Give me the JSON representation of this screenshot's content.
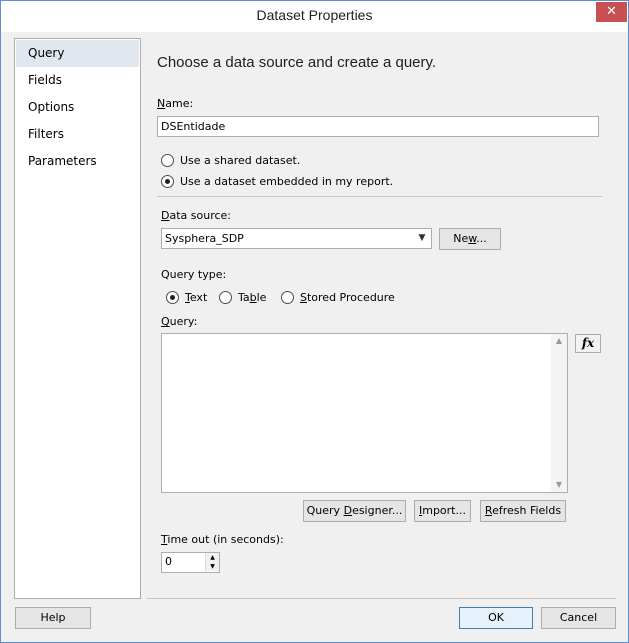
{
  "window": {
    "title": "Dataset Properties",
    "close_glyph": "✕"
  },
  "nav": {
    "items": [
      {
        "label": "Query",
        "selected": true
      },
      {
        "label": "Fields"
      },
      {
        "label": "Options"
      },
      {
        "label": "Filters"
      },
      {
        "label": "Parameters"
      }
    ]
  },
  "main": {
    "heading": "Choose a data source and create a query.",
    "name": {
      "label": {
        "key": "N",
        "suffix": "ame:"
      },
      "value": "DSEntidade"
    },
    "dataset_options": [
      {
        "label": "Use a shared dataset.",
        "checked": false
      },
      {
        "label": "Use a dataset embedded in my report.",
        "checked": true
      }
    ],
    "data_source": {
      "label": {
        "key": "D",
        "suffix": "ata source:"
      },
      "selected": "Sysphera_SDP",
      "new_button": {
        "prefix": "Ne",
        "key": "w",
        "suffix": "..."
      }
    },
    "query_type": {
      "label": "Query type:",
      "options": [
        {
          "key": "T",
          "suffix": "ext",
          "checked": true
        },
        {
          "prefix": "Ta",
          "key": "b",
          "suffix": "le",
          "checked": false
        },
        {
          "key": "S",
          "suffix": "tored Procedure",
          "checked": false
        }
      ]
    },
    "query": {
      "label": {
        "key": "Q",
        "suffix": "uery:"
      },
      "text": "",
      "expression_button": "fx"
    },
    "buttons": {
      "designer": {
        "prefix": "Query ",
        "key": "D",
        "suffix": "esigner..."
      },
      "import": {
        "key": "I",
        "suffix": "mport..."
      },
      "refresh": {
        "key": "R",
        "suffix": "efresh Fields"
      }
    },
    "timeout": {
      "label": {
        "key": "T",
        "suffix": "ime out (in seconds):"
      },
      "value": "0"
    }
  },
  "footer": {
    "help": "Help",
    "ok": "OK",
    "cancel": "Cancel"
  },
  "icons": {
    "close": "close-icon",
    "combo_arrow": "chevron-down-icon",
    "scroll_up": "scroll-up-icon",
    "scroll_down": "scroll-down-icon",
    "spin_up": "spin-up-icon",
    "spin_down": "spin-down-icon"
  },
  "colors": {
    "close_button": "#c75050",
    "nav_selected": "#e1e7ef",
    "default_button_border": "#3c7fb1"
  }
}
